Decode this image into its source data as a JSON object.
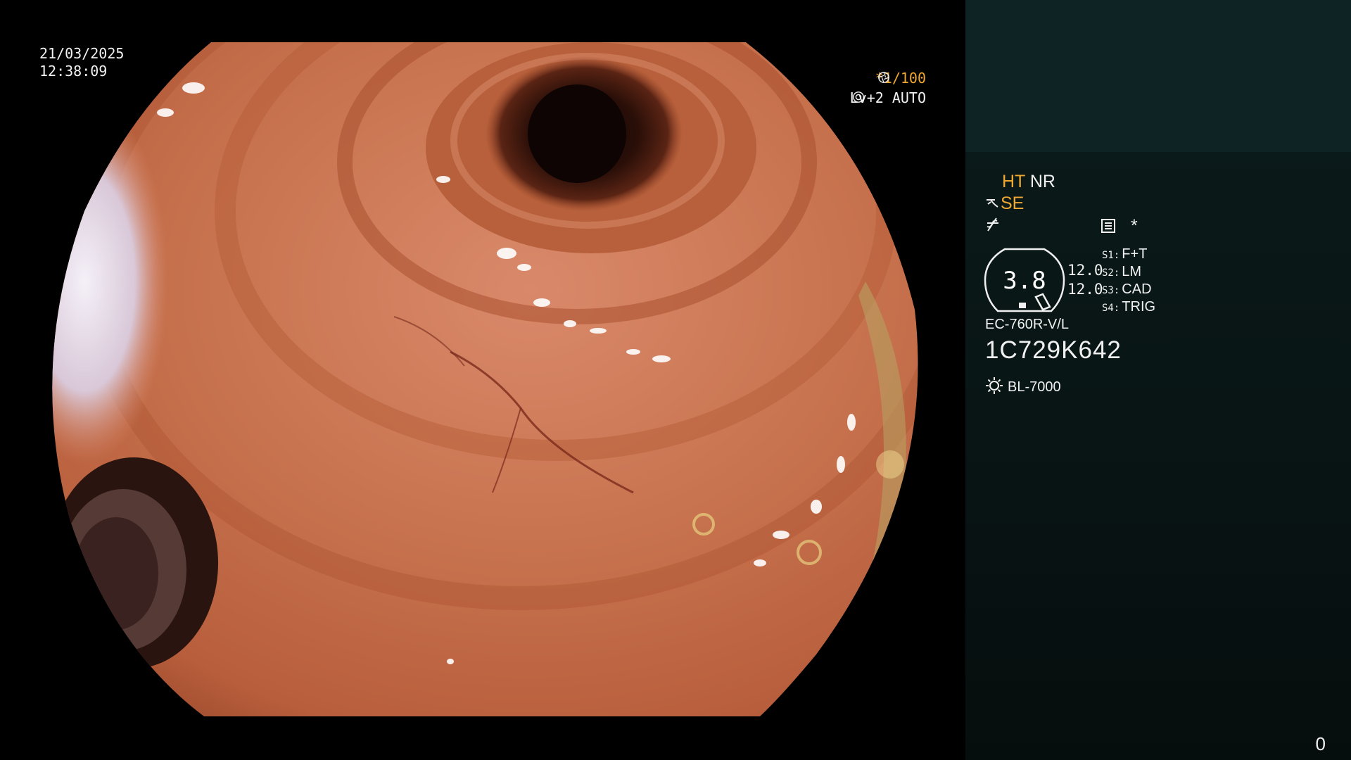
{
  "view": {
    "date": "21/03/2025",
    "time": "12:38:09",
    "shutter_mark": "*",
    "shutter": "1/100",
    "level": "Lv+2",
    "mode": "AUTO"
  },
  "panel": {
    "ht": "HT",
    "nr": "NR",
    "se": "SE",
    "asterisk": "*",
    "zoom": "3.8",
    "gain_1": "12.0",
    "gain_2": "12.0",
    "switches": [
      {
        "key": "S1:",
        "value": "F+T"
      },
      {
        "key": "S2:",
        "value": "LM"
      },
      {
        "key": "S3:",
        "value": "CAD"
      },
      {
        "key": "S4:",
        "value": "TRIG"
      }
    ],
    "model": "EC-760R-V/L",
    "serial": "1C729K642",
    "light_source": "BL-7000",
    "counter": "0"
  },
  "icons": {
    "shutter": "aperture-icon",
    "mode": "auto-mode-icon",
    "se": "scope-enhancement-icon",
    "enhance": "enhancement-icon",
    "document": "document-icon",
    "zoom_badge": "zoom-indicator-icon",
    "light": "light-source-icon"
  },
  "colors": {
    "accent": "#f0a830",
    "text": "#f0f0f0",
    "panel_bg": "#091515",
    "panel_top": "#0e2323",
    "mucosa": "#c06a4a"
  }
}
